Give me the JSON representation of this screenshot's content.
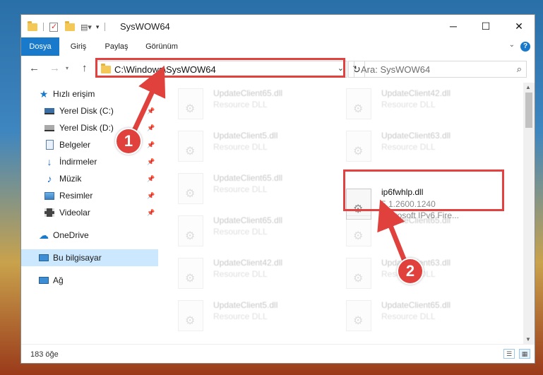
{
  "window": {
    "title": "SysWOW64",
    "controls": {
      "minimize": "─",
      "maximize": "☐",
      "close": "✕"
    }
  },
  "ribbon": {
    "tabs": [
      {
        "label": "Dosya",
        "active": true
      },
      {
        "label": "Giriş"
      },
      {
        "label": "Paylaş"
      },
      {
        "label": "Görünüm"
      }
    ],
    "help": "?"
  },
  "navigation": {
    "back": "←",
    "forward": "→",
    "up": "↑",
    "address_path": "C:\\Windows\\SysWOW64",
    "search_placeholder": "Ara: SysWOW64"
  },
  "sidebar": {
    "items": [
      {
        "label": "Hızlı erişim",
        "icon": "star-icon"
      },
      {
        "label": "Yerel Disk (C:)",
        "icon": "drive-icon",
        "pinned": true
      },
      {
        "label": "Yerel Disk (D:)",
        "icon": "drive-icon",
        "pinned": true
      },
      {
        "label": "Belgeler",
        "icon": "documents-icon",
        "pinned": true
      },
      {
        "label": "İndirmeler",
        "icon": "downloads-icon",
        "pinned": true
      },
      {
        "label": "Müzik",
        "icon": "music-icon",
        "pinned": true
      },
      {
        "label": "Resimler",
        "icon": "pictures-icon",
        "pinned": true
      },
      {
        "label": "Videolar",
        "icon": "videos-icon",
        "pinned": true
      },
      {
        "label": "OneDrive",
        "icon": "cloud-icon"
      },
      {
        "label": "Bu bilgisayar",
        "icon": "computer-icon",
        "selected": true
      },
      {
        "label": "Ağ",
        "icon": "network-icon"
      }
    ]
  },
  "files": {
    "left": [
      {
        "name": "UpdateClient65.dll",
        "type": "Resource DLL"
      },
      {
        "name": "UpdateClient5.dll",
        "type": "Resource DLL"
      },
      {
        "name": "UpdateClient65.dll",
        "type": "Resource DLL"
      },
      {
        "name": "UpdateClient65.dll",
        "type": "Resource DLL"
      },
      {
        "name": "UpdateClient42.dll",
        "type": "Resource DLL"
      },
      {
        "name": "UpdateClient5.dll",
        "type": "Resource DLL"
      }
    ],
    "right": [
      {
        "name": "UpdateClient42.dll",
        "type": "Resource DLL"
      },
      {
        "name": "UpdateClient63.dll",
        "type": "Resource DLL"
      },
      {
        "name": "UpdateClient63.dll",
        "type": "Resource DLL"
      },
      {
        "name": "UpdateClient65.dll",
        "type": "Resource DLL"
      }
    ],
    "highlighted": {
      "name": "ip6fwhlp.dll",
      "version": "5.1.2600.1240",
      "description": "Microsoft IPv6 Fire..."
    }
  },
  "status": {
    "count": "183 öğe"
  },
  "callouts": {
    "one": "1",
    "two": "2"
  },
  "colors": {
    "accent": "#1979ca",
    "highlight": "#e3413f",
    "selected": "#cce8ff"
  }
}
